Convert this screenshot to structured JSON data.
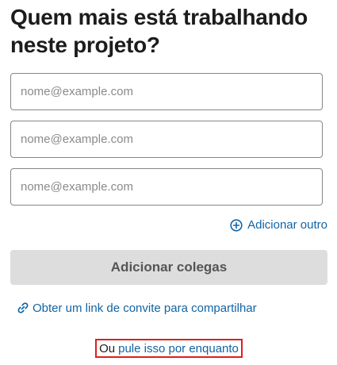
{
  "heading": "Quem mais está trabalhando neste projeto?",
  "email_fields": [
    {
      "placeholder": "nome@example.com",
      "value": ""
    },
    {
      "placeholder": "nome@example.com",
      "value": ""
    },
    {
      "placeholder": "nome@example.com",
      "value": ""
    }
  ],
  "add_another": {
    "label": "Adicionar outro",
    "icon": "plus-circle-icon"
  },
  "primary_button": {
    "label": "Adicionar colegas",
    "enabled": false
  },
  "invite_link": {
    "label": "Obter um link de convite para compartilhar",
    "icon": "link-icon"
  },
  "skip": {
    "prefix": "Ou",
    "link_label": "pule isso por enquanto"
  },
  "colors": {
    "link": "#1264a3",
    "text": "#1d1c1d",
    "button_disabled_bg": "#dddddd",
    "button_disabled_text": "#555555",
    "input_border": "#868686",
    "highlight_box": "#e01e1e"
  }
}
